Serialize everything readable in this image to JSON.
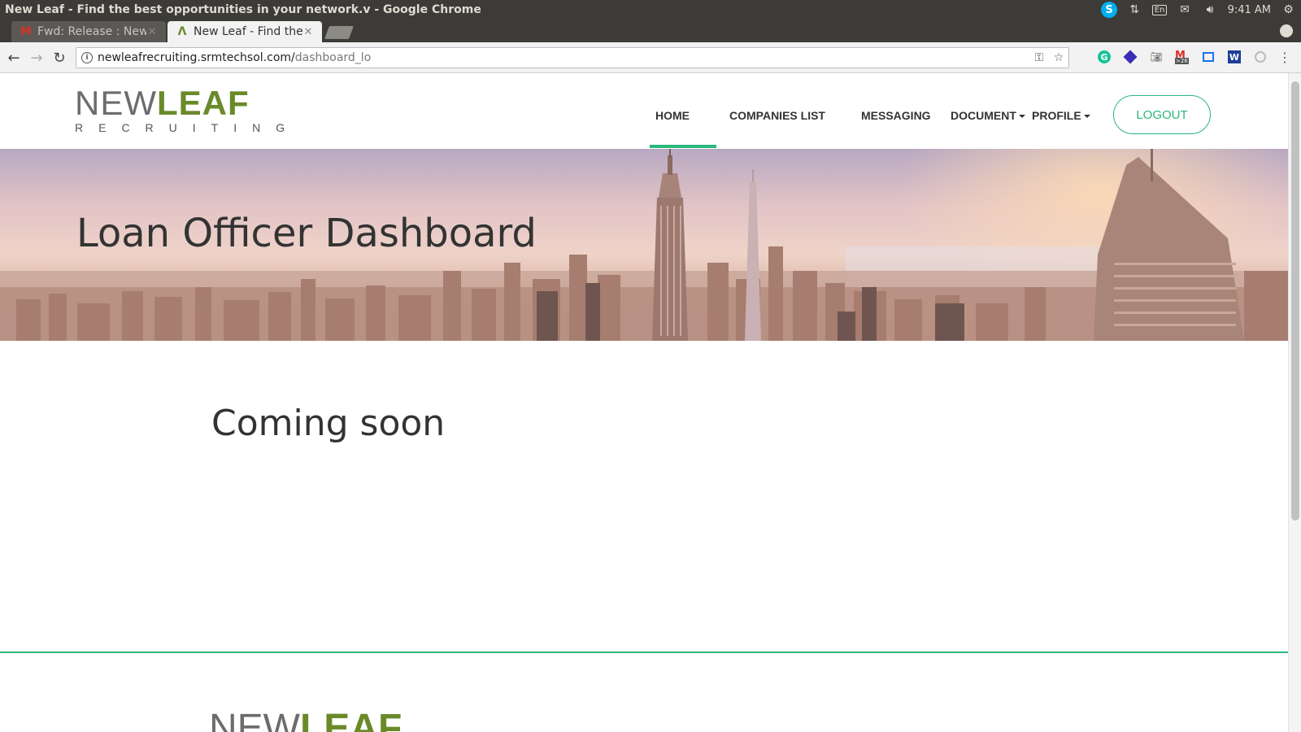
{
  "window": {
    "title": "New Leaf - Find the best opportunities in your network.v - Google Chrome",
    "clock": "9:41 AM",
    "tray": {
      "keyboard_layout": "En",
      "icons": [
        "skype-icon",
        "network-icon",
        "keyboard-icon",
        "mail-icon",
        "volume-icon",
        "settings-icon"
      ]
    }
  },
  "tabs": [
    {
      "label": "Fwd: Release : New",
      "icon": "gmail-icon",
      "active": false
    },
    {
      "label": "New Leaf - Find the",
      "icon": "newleaf-icon",
      "active": true
    }
  ],
  "toolbar": {
    "url_host": "newleafrecruiting.srmtechsol.com/",
    "url_path": "dashboard_lo",
    "extensions": [
      "grammarly-icon",
      "extension-blue-icon",
      "camera-icon",
      "gmail-checker-icon",
      "extension-box-icon",
      "w-icon",
      "extension-gray-icon",
      "menu-icon"
    ],
    "gmail_badge": ">2K"
  },
  "site": {
    "logo": {
      "new": "NEW",
      "leaf": "LEAF",
      "sub": "RECRUITING"
    },
    "nav": {
      "home": "HOME",
      "companies": "COMPANIES LIST",
      "messaging": "MESSAGING",
      "document": "DOCUMENT",
      "profile": "PROFILE",
      "logout": "LOGOUT"
    },
    "hero_title": "Loan Officer Dashboard",
    "main_text": "Coming soon",
    "footer_logo": {
      "new": "NEW",
      "leaf": "LEAF"
    }
  },
  "colors": {
    "accent": "#2bb67c",
    "brand_green": "#6a8a2a",
    "chrome_dark": "#3c3b37"
  }
}
